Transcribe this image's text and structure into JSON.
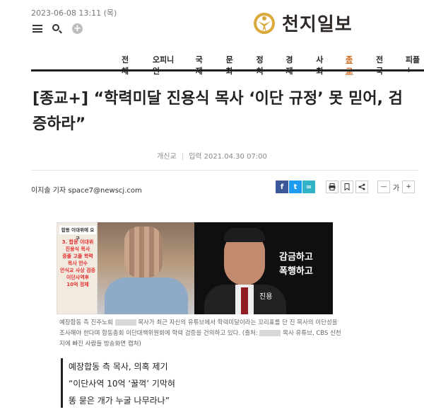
{
  "header": {
    "date": "2023-06-08 13:11 (목)",
    "logo_text": "천지일보",
    "logo_icon": "person-sun-logo",
    "menu_icon": "hamburger-icon",
    "search_icon": "search-icon",
    "plus_icon": "plus-icon"
  },
  "nav": {
    "items": [
      "전체",
      "오피니언",
      "국제",
      "문화",
      "정치",
      "경제",
      "사회",
      "종교",
      "전국",
      "피플+"
    ],
    "active": "종교",
    "active_color": "#d2691e"
  },
  "article": {
    "headline": "[종교+] “학력미달 진용식 목사 ‘이단 규정’ 못 믿어, 검증하라”",
    "author_short": "개신교",
    "date": "입력 2021.04.30 07:00",
    "byline": "이지솔 기자 space7@newscj.com"
  },
  "share": {
    "facebook": "f",
    "twitter": "t",
    "link": "∞",
    "colors": {
      "facebook": "#3b5998",
      "twitter": "#1d9bf0",
      "link": "#30b3c9"
    }
  },
  "tools": {
    "print_icon": "print-icon",
    "bookmark_icon": "bookmark-icon",
    "share_icon": "share-icon",
    "font_minus": "—",
    "font_label": "가",
    "font_plus": "+"
  },
  "photo": {
    "sign_title": "합동 이대위에 요구",
    "sign_lines": [
      "3. 합동 이대위",
      "진용식 목사",
      "중졸 고졸 학력",
      "목사 안수",
      "안식교 사상 검증",
      "이단사역후",
      "10억 정체"
    ],
    "right_caption_1": "감금하고",
    "right_caption_2": "폭행하고",
    "right_name": "진용"
  },
  "caption": {
    "part1": "예장합동 측 진주노회",
    "part2": "목사가 최근 자신의 유튜브에서 학력미달이라는 꼬리표를 단 진 목사의 이단성을 조사해야 한다며 합동총회 이단대책위원회에 학력 검증을 건의하고 있다. (출처:",
    "part3": "목사 유튜브, CBS 신천지에 빠진 사람들 방송화면 캡처)"
  },
  "subhead": {
    "lines": [
      "예장합동 측 목사, 의혹 제기",
      "“이단사역 10억 ‘꿀꺽’ 기막혀",
      "똥 묻은 개가 누굴 나무라나”"
    ]
  }
}
